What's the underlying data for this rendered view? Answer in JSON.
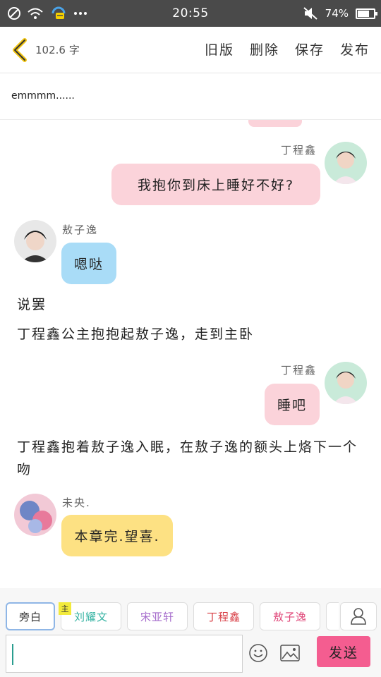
{
  "status_bar": {
    "time": "20:55",
    "battery_text": "74%",
    "battery_level": 0.74,
    "icons": [
      "blocked-icon",
      "wifi-icon",
      "message-app-icon",
      "more-dots-icon",
      "silent-icon",
      "battery-icon"
    ]
  },
  "header": {
    "word_count": "102.6 字",
    "actions": [
      "旧版",
      "删除",
      "保存",
      "发布"
    ]
  },
  "story": {
    "title": "emmmm......"
  },
  "characters": {
    "ding": {
      "name": "丁程鑫",
      "name_color": "#d9434a"
    },
    "ao": {
      "name": "敖子逸",
      "name_color": "#e0487a"
    },
    "liu": {
      "name": "刘耀文",
      "name_color": "#36b3a3"
    },
    "song": {
      "name": "宋亚轩",
      "name_color": "#a66ccc"
    },
    "author": {
      "name": "未央."
    }
  },
  "messages": [
    {
      "type": "right",
      "speaker": "丁程鑫",
      "text": "我抱你到床上睡好不好?"
    },
    {
      "type": "left",
      "speaker": "敖子逸",
      "text": "嗯哒"
    },
    {
      "type": "narration",
      "text": "说罢"
    },
    {
      "type": "narration",
      "text": "丁程鑫公主抱抱起敖子逸，走到主卧"
    },
    {
      "type": "right",
      "speaker": "丁程鑫",
      "text": "睡吧"
    },
    {
      "type": "narration",
      "text": "丁程鑫抱着敖子逸入眠，在敖子逸的额头上烙下一个吻"
    },
    {
      "type": "left",
      "speaker": "未央.",
      "text": "本章完.望喜."
    }
  ],
  "char_bar": {
    "chips": [
      "旁白",
      "刘耀文",
      "宋亚轩",
      "丁程鑫",
      "敖子逸"
    ],
    "host_badge": "主"
  },
  "input": {
    "placeholder": "",
    "send_label": "发送"
  },
  "colors": {
    "pink_bubble": "#fbd3da",
    "blue_bubble": "#a9dcf7",
    "yellow_bubble": "#fde183",
    "send_button": "#f45d90",
    "status_bar": "#4a4a4a"
  }
}
